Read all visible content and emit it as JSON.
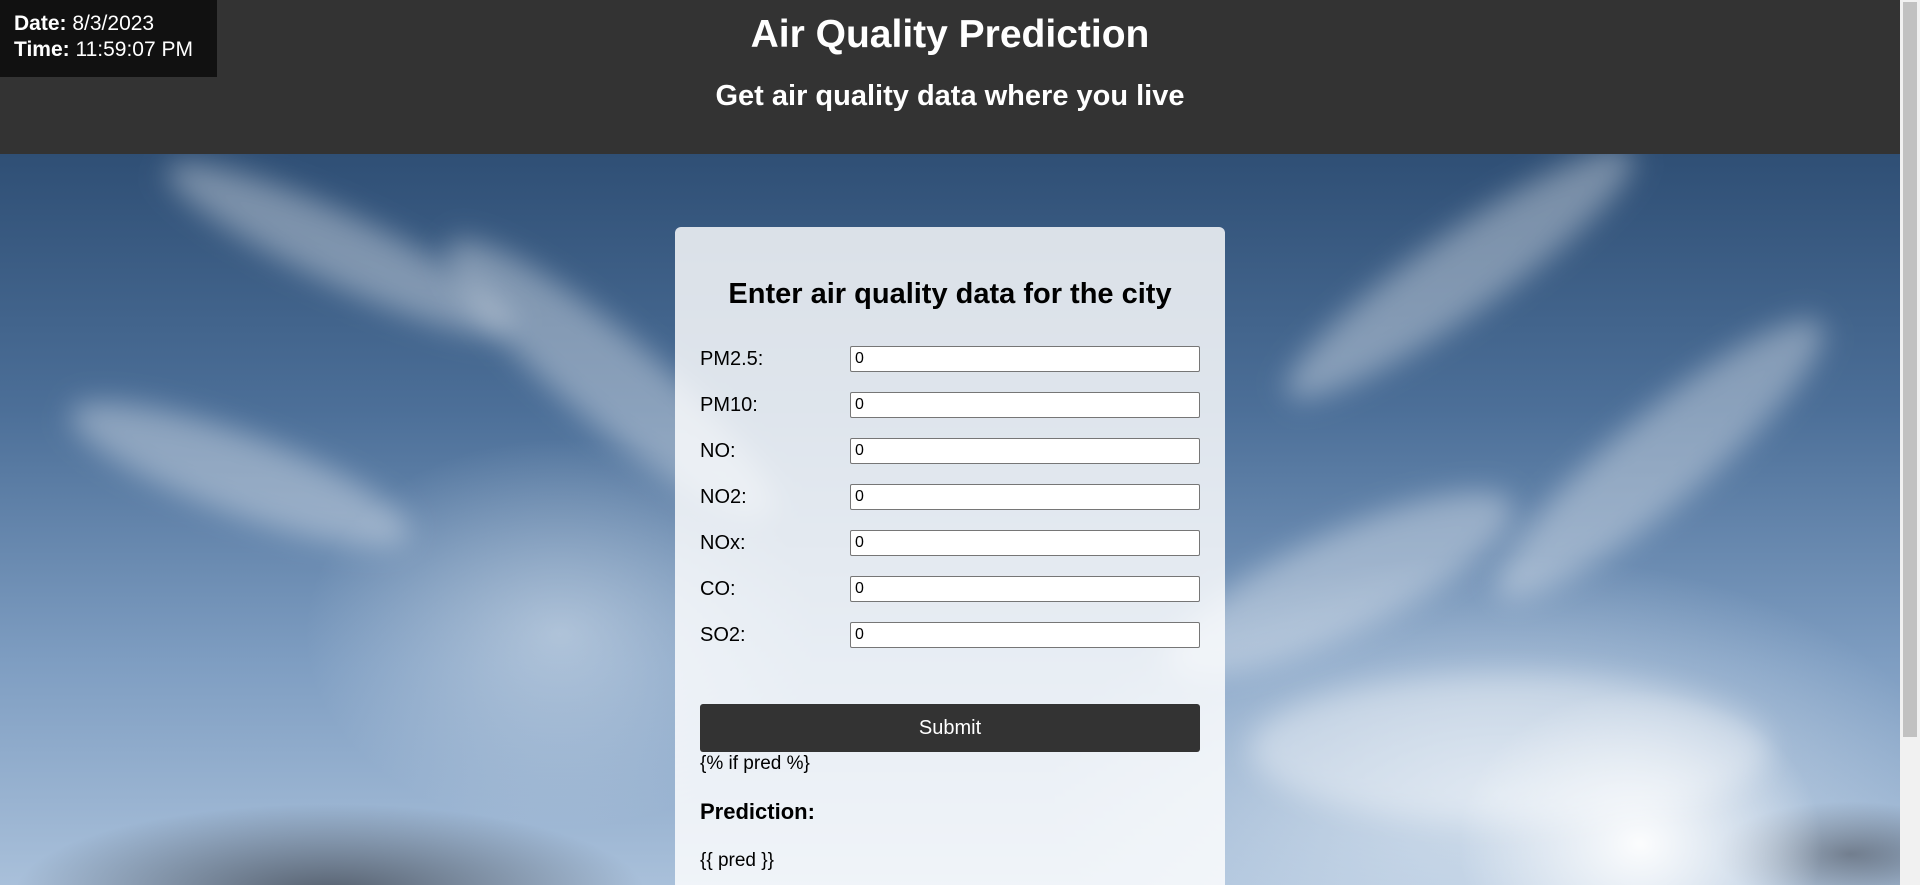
{
  "datetime": {
    "date_label": "Date:",
    "date_value": "8/3/2023",
    "time_label": "Time:",
    "time_value": "11:59:07 PM"
  },
  "header": {
    "title": "Air Quality Prediction",
    "subtitle": "Get air quality data where you live"
  },
  "form": {
    "heading": "Enter air quality data for the city",
    "fields": [
      {
        "label": "PM2.5:",
        "value": "0"
      },
      {
        "label": "PM10:",
        "value": "0"
      },
      {
        "label": "NO:",
        "value": "0"
      },
      {
        "label": "NO2:",
        "value": "0"
      },
      {
        "label": "NOx:",
        "value": "0"
      },
      {
        "label": "CO:",
        "value": "0"
      },
      {
        "label": "SO2:",
        "value": "0"
      }
    ],
    "submit_label": "Submit",
    "if_pred_text": "{% if pred %}",
    "prediction_heading": "Prediction:",
    "pred_placeholder_text": "{{ pred }}"
  },
  "colors": {
    "header_bg": "#333333",
    "datetime_bg": "#111111",
    "button_bg": "#333333",
    "card_bg": "rgba(255,255,255,0.82)"
  }
}
